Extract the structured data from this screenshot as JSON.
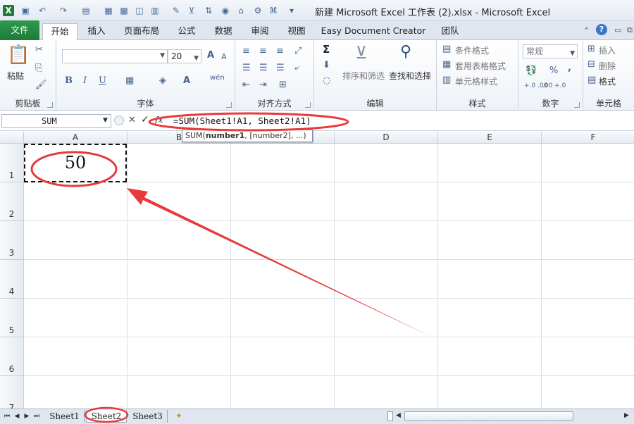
{
  "window": {
    "title": "新建 Microsoft Excel 工作表 (2).xlsx - Microsoft Excel"
  },
  "tabs": [
    "文件",
    "开始",
    "插入",
    "页面布局",
    "公式",
    "数据",
    "审阅",
    "视图",
    "Easy Document Creator",
    "团队"
  ],
  "ribbon": {
    "clipboard": {
      "label": "剪贴板",
      "paste": "粘贴"
    },
    "font": {
      "label": "字体",
      "size": "20",
      "bold": "B",
      "italic": "I",
      "underline": "U",
      "grow": "A",
      "shrink": "A",
      "color_a": "A",
      "wen": "wén"
    },
    "alignment": {
      "label": "对齐方式"
    },
    "number": {
      "label": "数字",
      "format": "常规",
      "percent": "%",
      "comma": ",",
      "inc_dec": "+.0 .00",
      "dec_dec": ".00 +.0"
    },
    "styles": {
      "label": "样式",
      "conditional": "条件格式",
      "table": "套用表格格式",
      "cell": "单元格样式"
    },
    "editing": {
      "label": "编辑",
      "sort": "排序和筛选",
      "find": "查找和选择",
      "sigma": "Σ"
    },
    "cells": {
      "label": "单元格",
      "insert": "插入",
      "delete": "删除",
      "format": "格式"
    }
  },
  "formula_bar": {
    "name_box": "SUM",
    "cancel": "✕",
    "enter": "✓",
    "fx": "fx",
    "formula": "=SUM(Sheet1!A1, Sheet2!A1)",
    "tooltip_fn": "SUM(",
    "tooltip_arg1": "number1",
    "tooltip_rest": ", [number2], ...)"
  },
  "grid": {
    "columns": [
      "A",
      "B",
      "C",
      "D",
      "E",
      "F"
    ],
    "rows": [
      "1",
      "2",
      "3",
      "4",
      "5",
      "6",
      "7"
    ],
    "a1_value": "50"
  },
  "sheets": [
    "Sheet1",
    "Sheet2",
    "Sheet3"
  ],
  "annotation_color": "#e8393b"
}
